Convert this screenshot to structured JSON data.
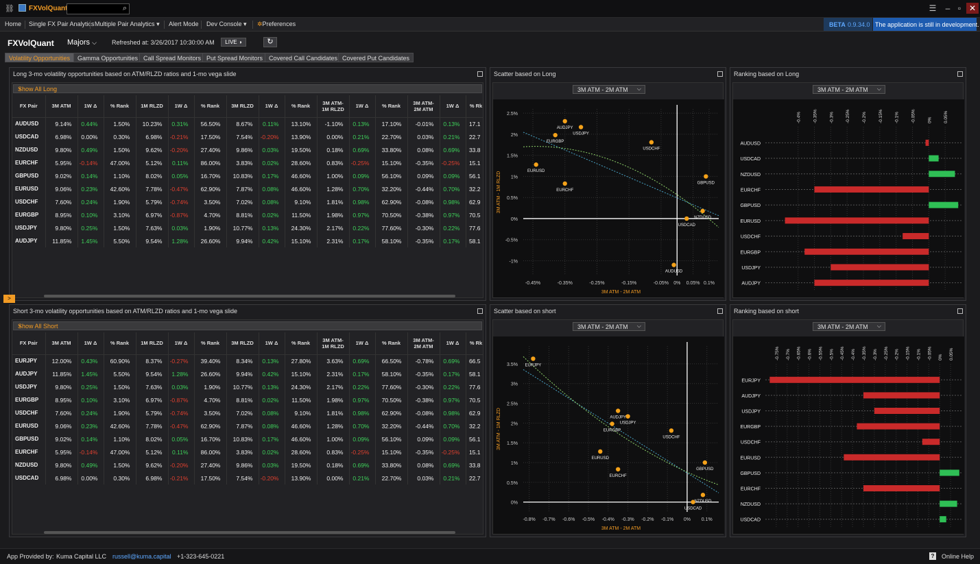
{
  "app": {
    "title": "FXVolQuant",
    "search_placeholder": ""
  },
  "menu": {
    "items": [
      "Home",
      "Single FX Pair Analytics",
      "Multiple Pair Analytics",
      "Alert Mode",
      "Dev Console",
      "Preferences"
    ]
  },
  "beta": {
    "label": "BETA",
    "version": "0.9.34.0",
    "message": "The application is still in development."
  },
  "header": {
    "title": "FXVolQuant",
    "universe": "Majors",
    "refreshed": "Refreshed at: 3/26/2017 10:30:00 AM",
    "live": "LIVE"
  },
  "tabs": [
    "Volatility Opportunities",
    "Gamma Opportunities",
    "Call Spread Monitors",
    "Put Spread Monitors",
    "Covered Call Candidates",
    "Covered Put Candidates"
  ],
  "long_panel": {
    "title": "Long 3-mo volatility opportunities based on ATM/RLZD ratios and 1-mo vega slide",
    "show_all": "Show All Long"
  },
  "short_panel": {
    "title": "Short 3-mo volatility opportunities based on ATM/RLZD ratios and 1-mo vega slide",
    "show_all": "Show All Short"
  },
  "columns": [
    "FX Pair",
    "3M ATM",
    "1W Δ",
    "% Rank",
    "1M RLZD",
    "1W Δ",
    "% Rank",
    "3M RLZD",
    "1W Δ",
    "% Rank",
    "3M ATM-\n1M RLZD",
    "1W Δ",
    "% Rank",
    "3M ATM-\n2M ATM",
    "1W Δ",
    "% Rk"
  ],
  "long_rows": [
    [
      "AUDUSD",
      "9.14%",
      "0.44%",
      "1.50%",
      "10.23%",
      "0.31%",
      "56.50%",
      "8.67%",
      "0.11%",
      "13.10%",
      "-1.10%",
      "0.13%",
      "17.10%",
      "-0.01%",
      "0.13%",
      "17.1"
    ],
    [
      "USDCAD",
      "6.98%",
      "0.00%",
      "0.30%",
      "6.98%",
      "-0.21%",
      "17.50%",
      "7.54%",
      "-0.20%",
      "13.90%",
      "0.00%",
      "0.21%",
      "22.70%",
      "0.03%",
      "0.21%",
      "22.7"
    ],
    [
      "NZDUSD",
      "9.80%",
      "0.49%",
      "1.50%",
      "9.62%",
      "-0.20%",
      "27.40%",
      "9.86%",
      "0.03%",
      "19.50%",
      "0.18%",
      "0.69%",
      "33.80%",
      "0.08%",
      "0.69%",
      "33.8"
    ],
    [
      "EURCHF",
      "5.95%",
      "-0.14%",
      "47.00%",
      "5.12%",
      "0.11%",
      "86.00%",
      "3.83%",
      "0.02%",
      "28.60%",
      "0.83%",
      "-0.25%",
      "15.10%",
      "-0.35%",
      "-0.25%",
      "15.1"
    ],
    [
      "GBPUSD",
      "9.02%",
      "0.14%",
      "1.10%",
      "8.02%",
      "0.05%",
      "16.70%",
      "10.83%",
      "0.17%",
      "46.60%",
      "1.00%",
      "0.09%",
      "56.10%",
      "0.09%",
      "0.09%",
      "56.1"
    ],
    [
      "EURUSD",
      "9.06%",
      "0.23%",
      "42.60%",
      "7.78%",
      "-0.47%",
      "62.90%",
      "7.87%",
      "0.08%",
      "46.60%",
      "1.28%",
      "0.70%",
      "32.20%",
      "-0.44%",
      "0.70%",
      "32.2"
    ],
    [
      "USDCHF",
      "7.60%",
      "0.24%",
      "1.90%",
      "5.79%",
      "-0.74%",
      "3.50%",
      "7.02%",
      "0.08%",
      "9.10%",
      "1.81%",
      "0.98%",
      "62.90%",
      "-0.08%",
      "0.98%",
      "62.9"
    ],
    [
      "EURGBP",
      "8.95%",
      "0.10%",
      "3.10%",
      "6.97%",
      "-0.87%",
      "4.70%",
      "8.81%",
      "0.02%",
      "11.50%",
      "1.98%",
      "0.97%",
      "70.50%",
      "-0.38%",
      "0.97%",
      "70.5"
    ],
    [
      "USDJPY",
      "9.80%",
      "0.25%",
      "1.50%",
      "7.63%",
      "0.03%",
      "1.90%",
      "10.77%",
      "0.13%",
      "24.30%",
      "2.17%",
      "0.22%",
      "77.60%",
      "-0.30%",
      "0.22%",
      "77.6"
    ],
    [
      "AUDJPY",
      "11.85%",
      "1.45%",
      "5.50%",
      "9.54%",
      "1.28%",
      "26.60%",
      "9.94%",
      "0.42%",
      "15.10%",
      "2.31%",
      "0.17%",
      "58.10%",
      "-0.35%",
      "0.17%",
      "58.1"
    ]
  ],
  "short_rows": [
    [
      "EURJPY",
      "12.00%",
      "0.43%",
      "60.90%",
      "8.37%",
      "-0.27%",
      "39.40%",
      "8.34%",
      "0.13%",
      "27.80%",
      "3.63%",
      "0.69%",
      "66.50%",
      "-0.78%",
      "0.69%",
      "66.5"
    ],
    [
      "AUDJPY",
      "11.85%",
      "1.45%",
      "5.50%",
      "9.54%",
      "1.28%",
      "26.60%",
      "9.94%",
      "0.42%",
      "15.10%",
      "2.31%",
      "0.17%",
      "58.10%",
      "-0.35%",
      "0.17%",
      "58.1"
    ],
    [
      "USDJPY",
      "9.80%",
      "0.25%",
      "1.50%",
      "7.63%",
      "0.03%",
      "1.90%",
      "10.77%",
      "0.13%",
      "24.30%",
      "2.17%",
      "0.22%",
      "77.60%",
      "-0.30%",
      "0.22%",
      "77.6"
    ],
    [
      "EURGBP",
      "8.95%",
      "0.10%",
      "3.10%",
      "6.97%",
      "-0.87%",
      "4.70%",
      "8.81%",
      "0.02%",
      "11.50%",
      "1.98%",
      "0.97%",
      "70.50%",
      "-0.38%",
      "0.97%",
      "70.5"
    ],
    [
      "USDCHF",
      "7.60%",
      "0.24%",
      "1.90%",
      "5.79%",
      "-0.74%",
      "3.50%",
      "7.02%",
      "0.08%",
      "9.10%",
      "1.81%",
      "0.98%",
      "62.90%",
      "-0.08%",
      "0.98%",
      "62.9"
    ],
    [
      "EURUSD",
      "9.06%",
      "0.23%",
      "42.60%",
      "7.78%",
      "-0.47%",
      "62.90%",
      "7.87%",
      "0.08%",
      "46.60%",
      "1.28%",
      "0.70%",
      "32.20%",
      "-0.44%",
      "0.70%",
      "32.2"
    ],
    [
      "GBPUSD",
      "9.02%",
      "0.14%",
      "1.10%",
      "8.02%",
      "0.05%",
      "16.70%",
      "10.83%",
      "0.17%",
      "46.60%",
      "1.00%",
      "0.09%",
      "56.10%",
      "0.09%",
      "0.09%",
      "56.1"
    ],
    [
      "EURCHF",
      "5.95%",
      "-0.14%",
      "47.00%",
      "5.12%",
      "0.11%",
      "86.00%",
      "3.83%",
      "0.02%",
      "28.60%",
      "0.83%",
      "-0.25%",
      "15.10%",
      "-0.35%",
      "-0.25%",
      "15.1"
    ],
    [
      "NZDUSD",
      "9.80%",
      "0.49%",
      "1.50%",
      "9.62%",
      "-0.20%",
      "27.40%",
      "9.86%",
      "0.03%",
      "19.50%",
      "0.18%",
      "0.69%",
      "33.80%",
      "0.08%",
      "0.69%",
      "33.8"
    ],
    [
      "USDCAD",
      "6.98%",
      "0.00%",
      "0.30%",
      "6.98%",
      "-0.21%",
      "17.50%",
      "7.54%",
      "-0.20%",
      "13.90%",
      "0.00%",
      "0.21%",
      "22.70%",
      "0.03%",
      "0.21%",
      "22.7"
    ]
  ],
  "scatter_long": {
    "title": "Scatter based on Long",
    "selector": "3M ATM - 2M ATM"
  },
  "scatter_short": {
    "title": "Scatter based on short",
    "selector": "3M ATM - 2M ATM"
  },
  "rank_long": {
    "title": "Ranking based on Long",
    "selector": "3M ATM - 2M ATM"
  },
  "rank_short": {
    "title": "Ranking based on short",
    "selector": "3M ATM - 2M ATM"
  },
  "chart_data": [
    {
      "type": "scatter",
      "title": "Scatter based on Long",
      "xlabel": "3M ATM - 2M ATM",
      "ylabel": "3M ATM - 1M RLZD",
      "x_ticks": [
        "-0.45%",
        "-0.35%",
        "-0.25%",
        "-0.15%",
        "-0.05%",
        "0%",
        "0.05%",
        "0.1%"
      ],
      "y_ticks": [
        "2.5%",
        "2%",
        "1.5%",
        "1%",
        "0.5%",
        "0%",
        "-0.5%",
        "-1%"
      ],
      "xlim": [
        -0.48,
        0.13
      ],
      "ylim": [
        -1.35,
        2.6
      ],
      "points": [
        {
          "name": "AUDJPY",
          "x": -0.35,
          "y": 2.31
        },
        {
          "name": "USDJPY",
          "x": -0.3,
          "y": 2.17
        },
        {
          "name": "EURGBP",
          "x": -0.38,
          "y": 1.98
        },
        {
          "name": "USDCHF",
          "x": -0.08,
          "y": 1.81
        },
        {
          "name": "EURUSD",
          "x": -0.44,
          "y": 1.28
        },
        {
          "name": "EURCHF",
          "x": -0.35,
          "y": 0.83
        },
        {
          "name": "GBPUSD",
          "x": 0.09,
          "y": 1.0
        },
        {
          "name": "NZDUSD",
          "x": 0.08,
          "y": 0.18
        },
        {
          "name": "USDCAD",
          "x": 0.03,
          "y": 0.0
        },
        {
          "name": "AUDUSD",
          "x": -0.01,
          "y": -1.1
        }
      ]
    },
    {
      "type": "bar",
      "title": "Ranking based on Long",
      "orientation": "horizontal",
      "x_ticks": [
        "-0.4%",
        "-0.35%",
        "-0.3%",
        "-0.25%",
        "-0.2%",
        "-0.15%",
        "-0.1%",
        "-0.05%",
        "0%",
        "0.05%"
      ],
      "xlim": [
        -0.5,
        0.1
      ],
      "categories": [
        "AUDUSD",
        "USDCAD",
        "NZDUSD",
        "EURCHF",
        "GBPUSD",
        "EURUSD",
        "USDCHF",
        "EURGBP",
        "USDJPY",
        "AUDJPY"
      ],
      "values": [
        -0.01,
        0.03,
        0.08,
        -0.35,
        0.09,
        -0.44,
        -0.08,
        -0.38,
        -0.3,
        -0.35
      ]
    },
    {
      "type": "scatter",
      "title": "Scatter based on short",
      "xlabel": "3M ATM - 2M ATM",
      "ylabel": "3M ATM - 1M RLZD",
      "x_ticks": [
        "-0.8%",
        "-0.7%",
        "-0.6%",
        "-0.5%",
        "-0.4%",
        "-0.3%",
        "-0.2%",
        "-0.1%",
        "0%",
        "0.1%"
      ],
      "y_ticks": [
        "3.5%",
        "3%",
        "2.5%",
        "2%",
        "1.5%",
        "1%",
        "0.5%",
        "0%"
      ],
      "xlim": [
        -0.83,
        0.16
      ],
      "ylim": [
        -0.25,
        3.95
      ],
      "points": [
        {
          "name": "EURJPY",
          "x": -0.78,
          "y": 3.63
        },
        {
          "name": "AUDJPY",
          "x": -0.35,
          "y": 2.31
        },
        {
          "name": "USDJPY",
          "x": -0.3,
          "y": 2.17
        },
        {
          "name": "EURGBP",
          "x": -0.38,
          "y": 1.98
        },
        {
          "name": "USDCHF",
          "x": -0.08,
          "y": 1.81
        },
        {
          "name": "EURUSD",
          "x": -0.44,
          "y": 1.28
        },
        {
          "name": "EURCHF",
          "x": -0.35,
          "y": 0.83
        },
        {
          "name": "GBPUSD",
          "x": 0.09,
          "y": 1.0
        },
        {
          "name": "NZDUSD",
          "x": 0.08,
          "y": 0.18
        },
        {
          "name": "USDCAD",
          "x": 0.03,
          "y": 0.0
        }
      ]
    },
    {
      "type": "bar",
      "title": "Ranking based on short",
      "orientation": "horizontal",
      "x_ticks": [
        "-0.75%",
        "-0.7%",
        "-0.65%",
        "-0.6%",
        "-0.55%",
        "-0.5%",
        "-0.45%",
        "-0.4%",
        "-0.35%",
        "-0.3%",
        "-0.25%",
        "-0.2%",
        "-0.15%",
        "-0.1%",
        "-0.05%",
        "0%",
        "0.05%"
      ],
      "xlim": [
        -0.8,
        0.1
      ],
      "categories": [
        "EURJPY",
        "AUDJPY",
        "USDJPY",
        "EURGBP",
        "USDCHF",
        "EURUSD",
        "GBPUSD",
        "EURCHF",
        "NZDUSD",
        "USDCAD"
      ],
      "values": [
        -0.78,
        -0.35,
        -0.3,
        -0.38,
        -0.08,
        -0.44,
        0.09,
        -0.35,
        0.08,
        0.03
      ]
    }
  ],
  "colors": {
    "accent": "#f29b24",
    "positive": "#3ed15a",
    "negative": "#e0402f",
    "bar_red": "#c92a2a",
    "bar_green": "#2fbf55",
    "point": "#f5a21a"
  },
  "footer": {
    "provider_label": "App Provided by:",
    "provider": "Kuma Capital LLC",
    "email": "russell@kuma.capital",
    "phone": "+1-323-645-0221",
    "help": "Online Help"
  }
}
